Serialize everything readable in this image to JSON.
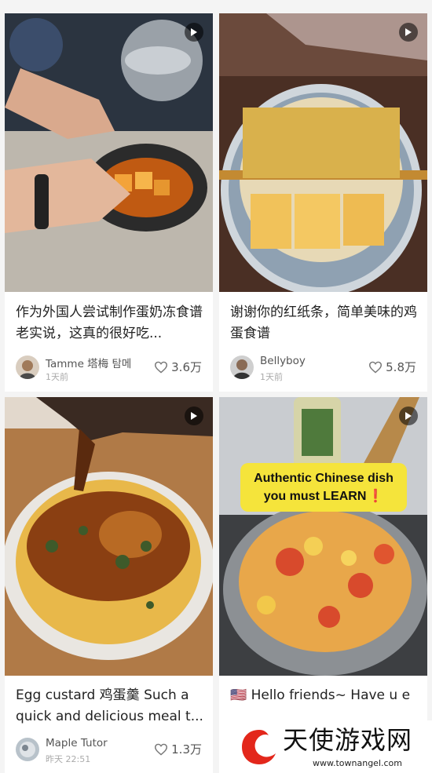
{
  "cards": [
    {
      "title": "作为外国人尝试制作蛋奶冻食谱 老实说，这真的很好吃...",
      "author": "Tamme 塔梅 탐메",
      "time": "1天前",
      "likes": "3.6万"
    },
    {
      "title": "谢谢你的红纸条，简单美味的鸡蛋食谱",
      "author": "Bellyboy",
      "time": "1天前",
      "likes": "5.8万"
    },
    {
      "title": "Egg custard 鸡蛋羹 Such a quick and delicious meal t...",
      "author": "Maple Tutor",
      "time": "昨天 22:51",
      "likes": "1.3万"
    },
    {
      "title": "🇺🇸 Hello friends~ Have u e",
      "overlay_text_line1": "Authentic Chinese dish",
      "overlay_text_line2": "you must LEARN",
      "overlay_mark": "❗"
    }
  ],
  "watermark": {
    "text": "天使游戏网",
    "url": "www.townangel.com"
  },
  "icons": {
    "play": "play-icon",
    "heart": "heart-outline-icon"
  }
}
